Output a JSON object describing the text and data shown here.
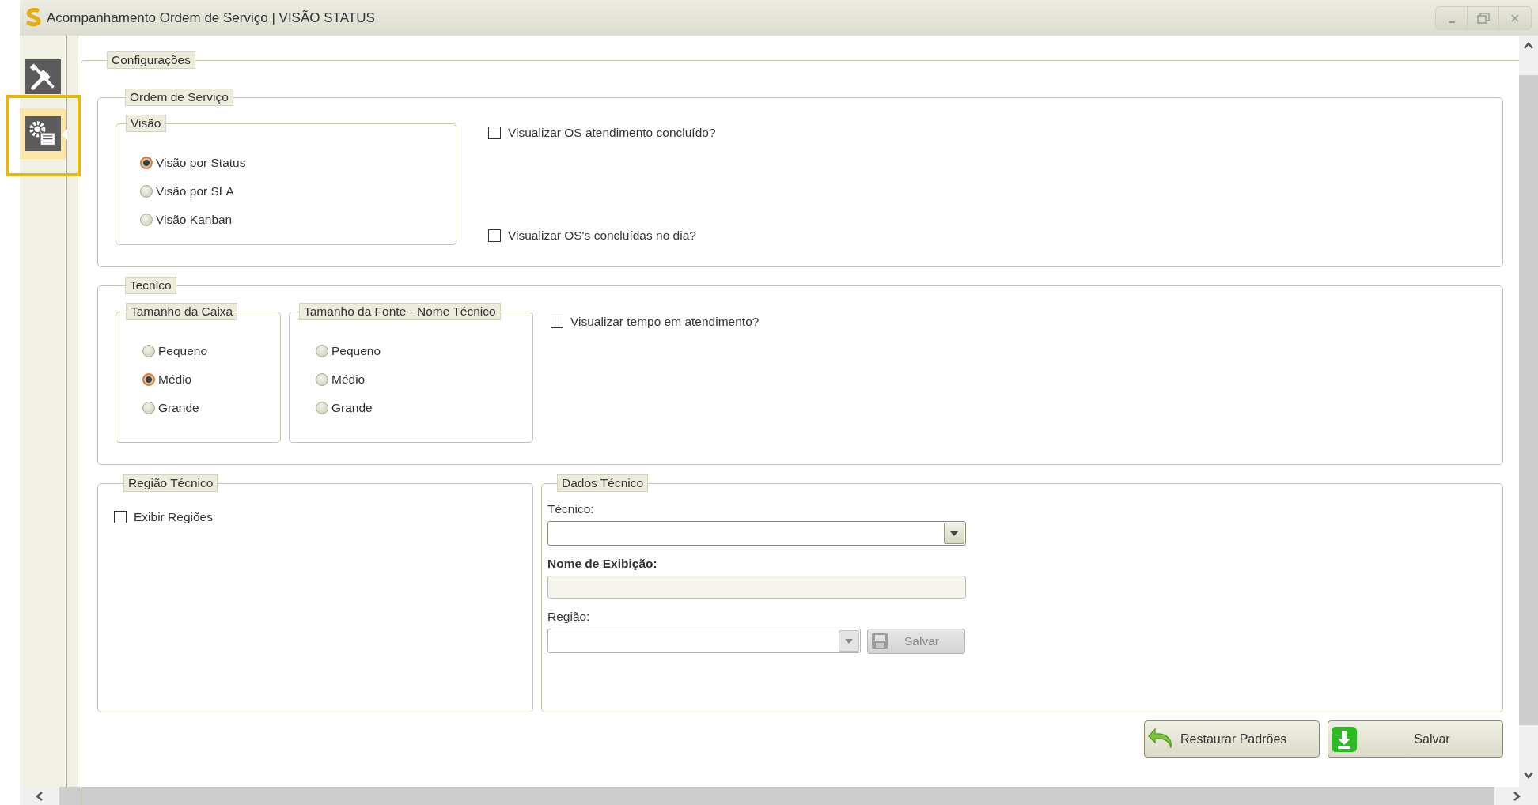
{
  "window": {
    "title": "Acompanhamento Ordem de Serviço | VISÃO STATUS"
  },
  "sidebar": {
    "items": [
      {
        "kind": "tools",
        "selected": false
      },
      {
        "kind": "settings",
        "selected": true
      }
    ]
  },
  "configuracoes": {
    "legend": "Configurações",
    "ordem_de_servico": {
      "legend": "Ordem de Serviço",
      "visao": {
        "legend": "Visão",
        "options": [
          {
            "label": "Visão por Status",
            "selected": true
          },
          {
            "label": "Visão por SLA",
            "selected": false
          },
          {
            "label": "Visão Kanban",
            "selected": false
          }
        ]
      },
      "checkboxes": [
        {
          "label": "Visualizar OS atendimento concluído?",
          "checked": false
        },
        {
          "label": "Visualizar OS's concluídas no dia?",
          "checked": false
        }
      ]
    },
    "tecnico": {
      "legend": "Tecnico",
      "groups": [
        {
          "legend": "Tamanho da Caixa",
          "options": [
            {
              "label": "Pequeno",
              "selected": false
            },
            {
              "label": "Médio",
              "selected": true
            },
            {
              "label": "Grande",
              "selected": false
            }
          ]
        },
        {
          "legend": "Tamanho da Fonte - Nome Técnico",
          "options": [
            {
              "label": "Pequeno",
              "selected": false
            },
            {
              "label": "Médio",
              "selected": false
            },
            {
              "label": "Grande",
              "selected": false
            }
          ]
        }
      ],
      "checkboxes": [
        {
          "label": "Visualizar tempo em atendimento?",
          "checked": false
        }
      ]
    },
    "regiao_tecnico": {
      "legend": "Região Técnico",
      "checkboxes": [
        {
          "label": "Exibir Regiões",
          "checked": false
        }
      ]
    },
    "dados_tecnico": {
      "legend": "Dados Técnico",
      "tecnico_field": {
        "label": "Técnico:",
        "disabled": false
      },
      "nome_exibicao": {
        "label": "Nome de Exibição:",
        "disabled": true
      },
      "regiao_field": {
        "label": "Região:",
        "disabled": true,
        "button": {
          "label": "Salvar",
          "disabled": true
        }
      }
    }
  },
  "buttons": [
    {
      "kind": "restore",
      "label": "Restaurar Padrões"
    },
    {
      "kind": "save",
      "label": "Salvar"
    }
  ]
}
